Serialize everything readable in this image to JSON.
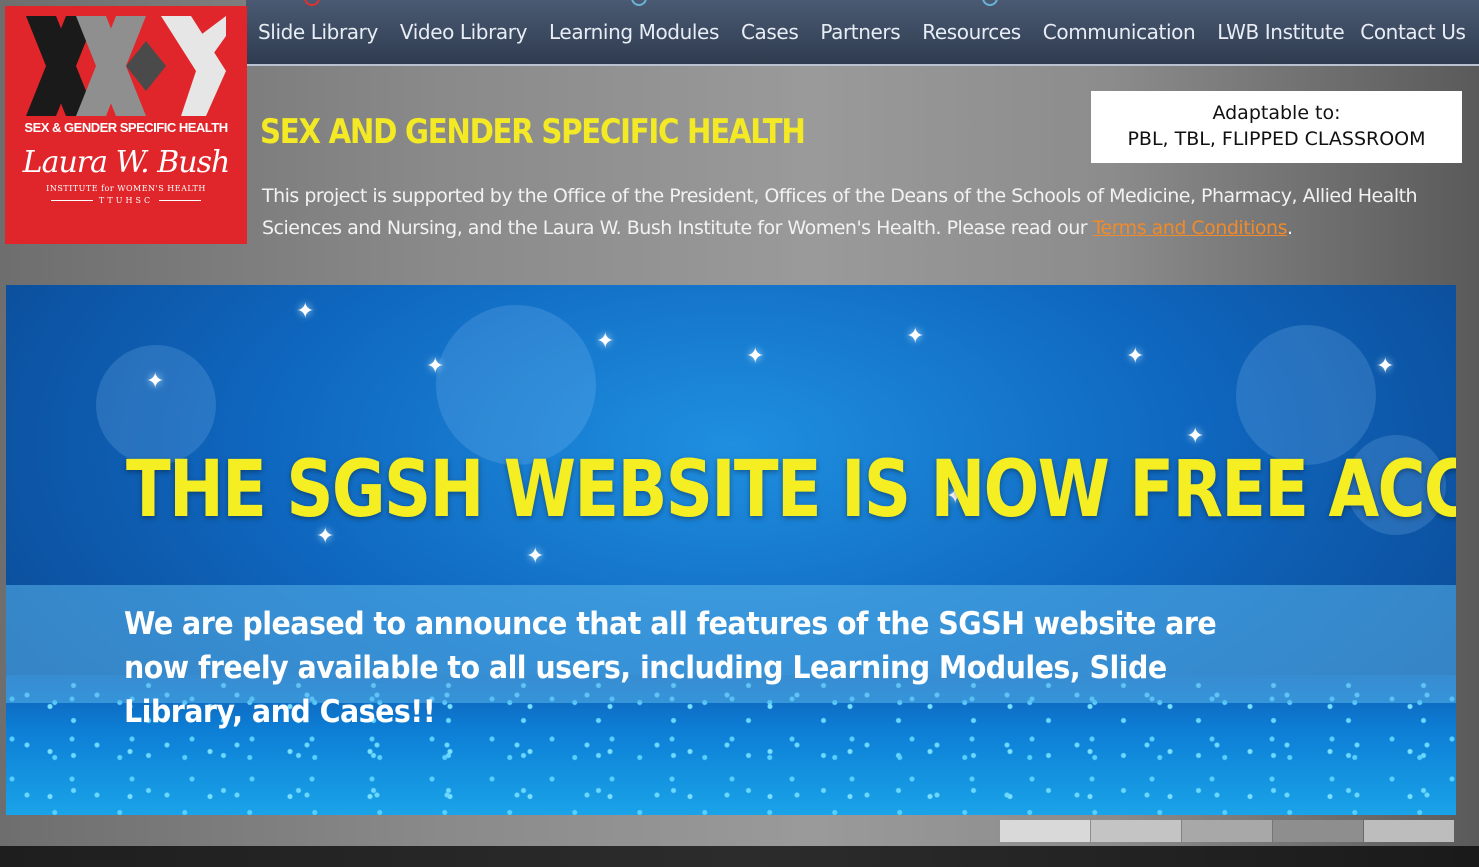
{
  "nav": {
    "items": [
      "Slide Library",
      "Video Library",
      "Learning Modules",
      "Cases",
      "Partners",
      "Resources",
      "Communication",
      "LWB Institute",
      "Contact Us"
    ]
  },
  "logo": {
    "tagline": "SEX & GENDER SPECIFIC HEALTH",
    "signature": "Laura W. Bush",
    "institute": "INSTITUTE for WOMEN'S HEALTH",
    "ttuhsc": "TTUHSC"
  },
  "header": {
    "title": "SEX AND GENDER SPECIFIC HEALTH",
    "description": "This project is supported by the Office of the President, Offices of the Deans of the Schools of Medicine, Pharmacy, Allied Health Sciences and Nursing, and the Laura W. Bush Institute for Women's Health. Please read our ",
    "terms_link": "Terms and Conditions",
    "terms_suffix": "."
  },
  "callout": {
    "line1": "Adaptable to:",
    "line2": "PBL, TBL, FLIPPED CLASSROOM"
  },
  "banner": {
    "headline": "THE SGSH WEBSITE IS NOW FREE ACCESS!!",
    "message": "We are pleased to announce that all features of the SGSH website are now freely available to all users, including Learning Modules, Slide Library, and Cases!!"
  },
  "slider": {
    "indicator_colors": [
      "#d9d9d9",
      "#c4c4c4",
      "#a8a8a8",
      "#8e8e8e",
      "#bdbdbd"
    ]
  },
  "colors": {
    "logo_red": "#e0262a",
    "title_yellow": "#f3ea25",
    "link_orange": "#f08a2a",
    "nav_bg": "#3a485e"
  }
}
